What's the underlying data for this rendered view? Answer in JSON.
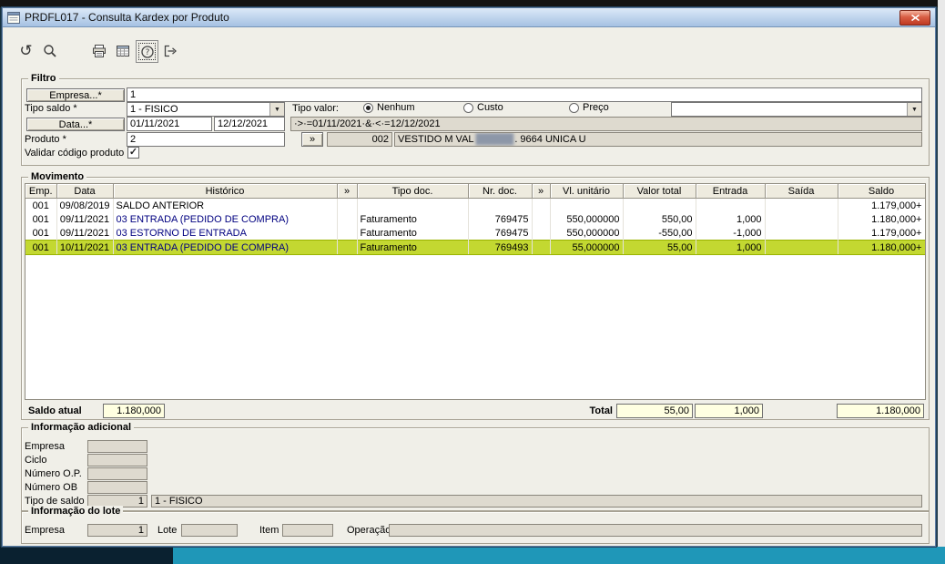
{
  "window": {
    "title": "PRDFL017 - Consulta Kardex por Produto"
  },
  "toolbar": {
    "icons": [
      "undo-icon",
      "search-icon",
      "print-icon",
      "calendar-icon",
      "help-icon",
      "exit-icon"
    ]
  },
  "filtro": {
    "title": "Filtro",
    "empresa_button": "Empresa...*",
    "empresa_value": "1",
    "tipo_saldo_label": "Tipo saldo *",
    "tipo_saldo_value": "1 - FISICO",
    "tipo_valor_label": "Tipo valor:",
    "radios": [
      {
        "label": "Nenhum",
        "checked": true
      },
      {
        "label": "Custo",
        "checked": false
      },
      {
        "label": "Preço",
        "checked": false
      }
    ],
    "data_button": "Data...*",
    "data_inicio": "01/11/2021",
    "data_fim": "12/12/2021",
    "data_expressao": "·>·=01/11/2021·&·<·=12/12/2021",
    "produto_label": "Produto *",
    "produto_value": "2",
    "expand_button": "»",
    "produto_codigo": "002",
    "produto_desc_prefix": "VESTIDO M VAL",
    "produto_desc_masked": "██████",
    "produto_desc_suffix": ". 9664 UNICA U",
    "validar_label": "Validar código produto",
    "validar_checked": true
  },
  "movimento": {
    "title": "Movimento",
    "columns": [
      "Emp.",
      "Data",
      "Histórico",
      "»",
      "Tipo doc.",
      "Nr. doc.",
      "»",
      "Vl. unitário",
      "Valor total",
      "Entrada",
      "Saída",
      "Saldo"
    ],
    "rows": [
      {
        "cells": [
          "001",
          "09/08/2019",
          "SALDO ANTERIOR",
          "",
          "",
          "",
          "",
          "",
          "",
          "",
          "",
          "1.179,000+"
        ],
        "highlight": false,
        "historico_blue": false
      },
      {
        "cells": [
          "001",
          "09/11/2021",
          "03 ENTRADA (PEDIDO DE COMPRA)",
          "",
          "Faturamento",
          "769475",
          "",
          "550,000000",
          "550,00",
          "1,000",
          "",
          "1.180,000+"
        ],
        "highlight": false,
        "historico_blue": true
      },
      {
        "cells": [
          "001",
          "09/11/2021",
          "03 ESTORNO DE ENTRADA",
          "",
          "Faturamento",
          "769475",
          "",
          "550,000000",
          "-550,00",
          "-1,000",
          "",
          "1.179,000+"
        ],
        "highlight": false,
        "historico_blue": true
      },
      {
        "cells": [
          "001",
          "10/11/2021",
          "03 ENTRADA (PEDIDO DE COMPRA)",
          "",
          "Faturamento",
          "769493",
          "",
          "55,000000",
          "55,00",
          "1,000",
          "",
          "1.180,000+"
        ],
        "highlight": true,
        "historico_blue": true
      }
    ],
    "saldo_atual_label": "Saldo atual",
    "saldo_atual_value": "1.180,000",
    "total_label": "Total",
    "total_valor_total": "55,00",
    "total_entrada": "1,000",
    "total_saldo": "1.180,000"
  },
  "info_adicional": {
    "title": "Informação adicional",
    "fields": [
      {
        "label": "Empresa",
        "value": ""
      },
      {
        "label": "Ciclo",
        "value": ""
      },
      {
        "label": "Número O.P.",
        "value": ""
      },
      {
        "label": "Número OB",
        "value": ""
      },
      {
        "label": "Tipo de saldo",
        "value": "1",
        "extra": "1 - FISICO"
      }
    ]
  },
  "info_lote": {
    "title": "Informação do lote",
    "empresa_label": "Empresa",
    "empresa_value": "1",
    "lote_label": "Lote",
    "lote_value": "",
    "item_label": "Item",
    "item_value": "",
    "operacao_label": "Operação",
    "operacao_value": ""
  },
  "colors": {
    "highlight_row": "#c3d831",
    "total_field_bg": "#ffffe1",
    "titlebar_top": "#dce9f8",
    "titlebar_bottom": "#a5c1e2",
    "close_red": "#c03a22"
  }
}
